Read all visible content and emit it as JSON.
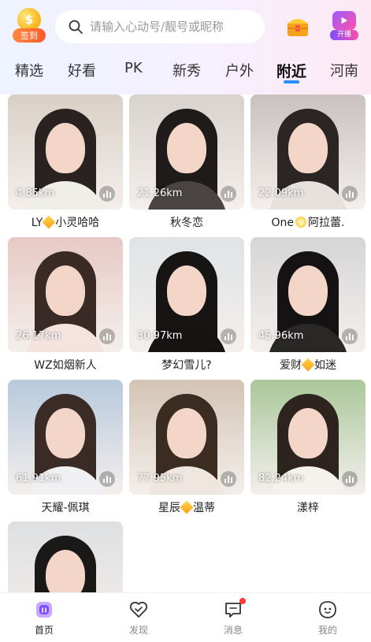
{
  "header": {
    "signin": {
      "coin_glyph": "$",
      "label": "签到"
    },
    "search_placeholder": "请输入心动号/靓号或昵称",
    "live_label": "开播"
  },
  "tabs": [
    {
      "label": "精选"
    },
    {
      "label": "好看"
    },
    {
      "label": "PK"
    },
    {
      "label": "新秀"
    },
    {
      "label": "户外"
    },
    {
      "label": "附近",
      "active": true
    },
    {
      "label": "河南"
    }
  ],
  "cards": [
    {
      "distance": "4.85km",
      "name_pre": "LY",
      "badge": "diamond",
      "name_post": "小灵哈哈",
      "bg": "#d9cfc6",
      "hair": "#2a2220",
      "body": "#f0eee9"
    },
    {
      "distance": "21.26km",
      "name_pre": "秋冬恋",
      "badge": "",
      "name_post": "",
      "bg": "#d7d2cc",
      "hair": "#1f1b1a",
      "body": "#4a4442"
    },
    {
      "distance": "22.09km",
      "name_pre": "One",
      "badge": "flower",
      "name_post": "阿拉蕾.",
      "bg": "#c9c1c0",
      "hair": "#2b2624",
      "body": "#e6e1dc"
    },
    {
      "distance": "26.17km",
      "name_pre": "WZ如烟新人",
      "badge": "",
      "name_post": "",
      "bg": "#e7c9c4",
      "hair": "#3a2a26",
      "body": "#f5e3e0"
    },
    {
      "distance": "30.97km",
      "name_pre": "梦幻雪儿?",
      "badge": "",
      "name_post": "",
      "bg": "#dfe3e6",
      "hair": "#171414",
      "body": "#161313"
    },
    {
      "distance": "45.96km",
      "name_pre": "爱财",
      "badge": "diamond",
      "name_post": "如迷",
      "bg": "#d6d6d6",
      "hair": "#141212",
      "body": "#2a2727"
    },
    {
      "distance": "61.91km",
      "name_pre": "天耀-佩琪",
      "badge": "",
      "name_post": "",
      "bg": "#b7c9dc",
      "hair": "#3a2b26",
      "body": "#f0f0f2"
    },
    {
      "distance": "77.95km",
      "name_pre": "星辰",
      "badge": "diamond",
      "name_post": "温蒂",
      "bg": "#d3c4b4",
      "hair": "#3b2c22",
      "body": "#efe7df"
    },
    {
      "distance": "82.24km",
      "name_pre": "漾梓",
      "badge": "",
      "name_post": "",
      "bg": "#a9c79a",
      "hair": "#2d241f",
      "body": "#f5f1ec"
    },
    {
      "distance": "",
      "name_pre": "",
      "badge": "",
      "name_post": "",
      "bg": "#dfe0e2",
      "hair": "#1b1818",
      "body": "#cfcfcf"
    }
  ],
  "bottom_nav": [
    {
      "label": "首页",
      "icon": "home-icon",
      "active": true
    },
    {
      "label": "发现",
      "icon": "heart-icon"
    },
    {
      "label": "消息",
      "icon": "message-icon",
      "badge": true
    },
    {
      "label": "我的",
      "icon": "profile-icon"
    }
  ],
  "colors": {
    "accent": "#2d8cff",
    "active_nav": "#7a4dff",
    "notification": "#ff3b3b"
  }
}
